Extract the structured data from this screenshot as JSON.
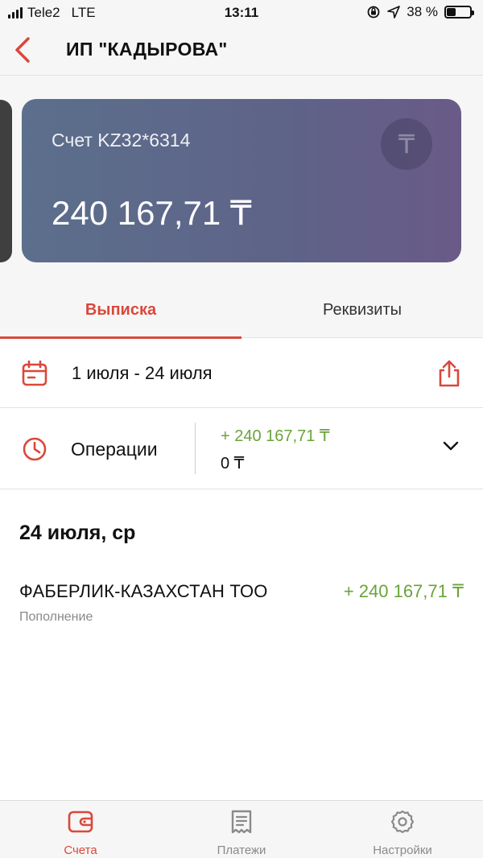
{
  "status_bar": {
    "carrier": "Tele2",
    "network": "LTE",
    "time": "13:11",
    "battery": "38 %",
    "battery_level": 0.38
  },
  "nav": {
    "title": "ИП \"КАДЫРОВА\""
  },
  "card": {
    "account": "Счет KZ32*6314",
    "balance": "240 167,71 ₸",
    "currency_symbol": "₸"
  },
  "tabs": [
    {
      "label": "Выписка",
      "active": true
    },
    {
      "label": "Реквизиты",
      "active": false
    }
  ],
  "period": {
    "range": "1 июля - 24 июля"
  },
  "operations": {
    "label": "Операции",
    "income": "+ 240 167,71 ₸",
    "expense": "0 ₸"
  },
  "day_groups": [
    {
      "date": "24 июля, ср",
      "transactions": [
        {
          "name": "ФАБЕРЛИК-КАЗАХСТАН ТОО",
          "type": "Пополнение",
          "amount": "+ 240 167,71 ₸"
        }
      ]
    }
  ],
  "tab_bar": [
    {
      "label": "Счета",
      "icon": "wallet-icon",
      "active": true
    },
    {
      "label": "Платежи",
      "icon": "receipt-icon",
      "active": false
    },
    {
      "label": "Настройки",
      "icon": "gear-icon",
      "active": false
    }
  ],
  "colors": {
    "accent": "#d9483b",
    "positive": "#6ba33b",
    "card_gradient_start": "#5c6f8c",
    "card_gradient_end": "#6a5a88"
  }
}
